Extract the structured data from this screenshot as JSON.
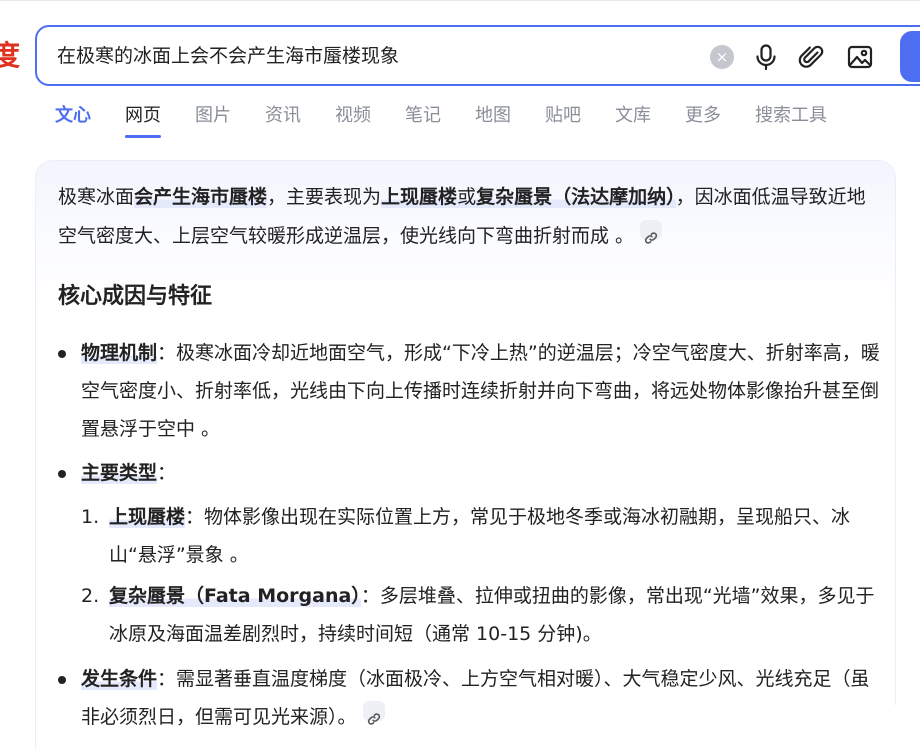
{
  "logo": {
    "fragment": "度"
  },
  "search": {
    "query": "在极寒的冰面上会不会产生海市蜃楼现象",
    "clear_label": "×"
  },
  "tabs": [
    {
      "label": "文心"
    },
    {
      "label": "网页"
    },
    {
      "label": "图片"
    },
    {
      "label": "资讯"
    },
    {
      "label": "视频"
    },
    {
      "label": "笔记"
    },
    {
      "label": "地图"
    },
    {
      "label": "贴吧"
    },
    {
      "label": "文库"
    },
    {
      "label": "更多"
    },
    {
      "label": "搜索工具"
    }
  ],
  "answer": {
    "intro": {
      "p1": "极寒冰面",
      "p2": "会产生海市蜃楼",
      "p3": "，主要表现为",
      "p4": "上现蜃楼",
      "p5": "或",
      "p6": "复杂蜃景（法达摩加纳）",
      "p7": "，因冰面低温导致近地空气密度大、上层空气较暖形成逆温层，使光线向下弯曲折射而成 。"
    },
    "heading": "核心成因与特征",
    "bullet1": {
      "term": "物理机制",
      "text": "：极寒冰面冷却近地面空气，形成“下冷上热”的逆温层；冷空气密度大、折射率高，暖空气密度小、折射率低，光线由下向上传播时连续折射并向下弯曲，将远处物体影像抬升甚至倒置悬浮于空中 。"
    },
    "bullet2": {
      "term": "主要类型",
      "text": "："
    },
    "sub1": {
      "num": "1.",
      "term": "上现蜃楼",
      "text": "：物体影像出现在实际位置上方，常见于极地冬季或海冰初融期，呈现船只、冰山“悬浮”景象 。"
    },
    "sub2": {
      "num": "2.",
      "term": "复杂蜃景（Fata Morgana）",
      "text": "：多层堆叠、拉伸或扭曲的影像，常出现“光墙”效果，多见于冰原及海面温差剧烈时，持续时间短（通常 10-15 分钟)。"
    },
    "bullet3": {
      "term": "发生条件",
      "text": "：需显著垂直温度梯度（冰面极冷、上方空气相对暖）、大气稳定少风、光线充足（虽非必须烈日，但需可见光来源）。"
    }
  },
  "colors": {
    "accent": "#4e6ef2",
    "logo": "#e0301e",
    "highlight": "#e5e9fc"
  }
}
